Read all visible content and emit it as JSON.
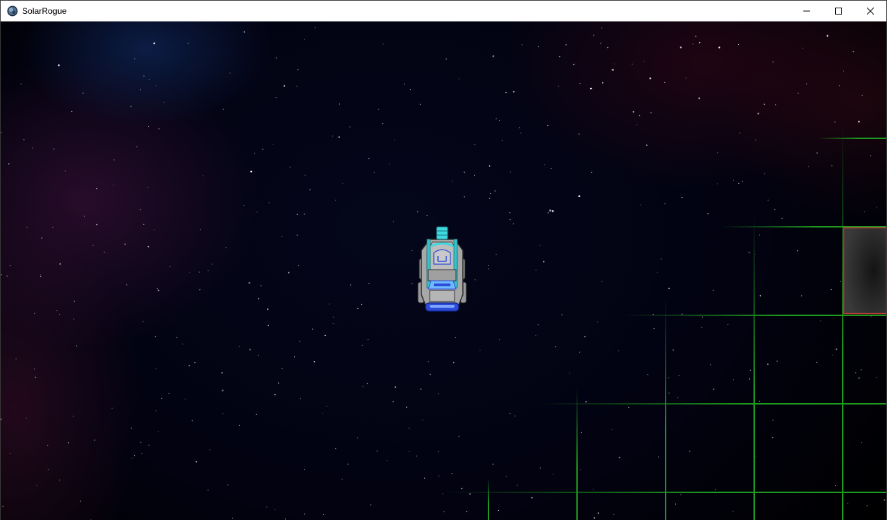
{
  "window": {
    "title": "SolarRogue",
    "app_icon": "solarrogue-planet-icon",
    "controls": {
      "minimize_icon": "minimize-icon",
      "maximize_icon": "maximize-icon",
      "close_icon": "close-icon"
    }
  },
  "game": {
    "background": "starfield-nebula",
    "player_ship": {
      "name": "player-ship",
      "colors": {
        "hull": "#a9a9a9",
        "trim": "#3fd7e0",
        "cockpit": "#2b4bd8"
      }
    },
    "grid": {
      "color": "#1e9a1e",
      "highlight_cell_border": "#c83a3a",
      "highlight_cell_fill": "#2a2a2a"
    }
  }
}
